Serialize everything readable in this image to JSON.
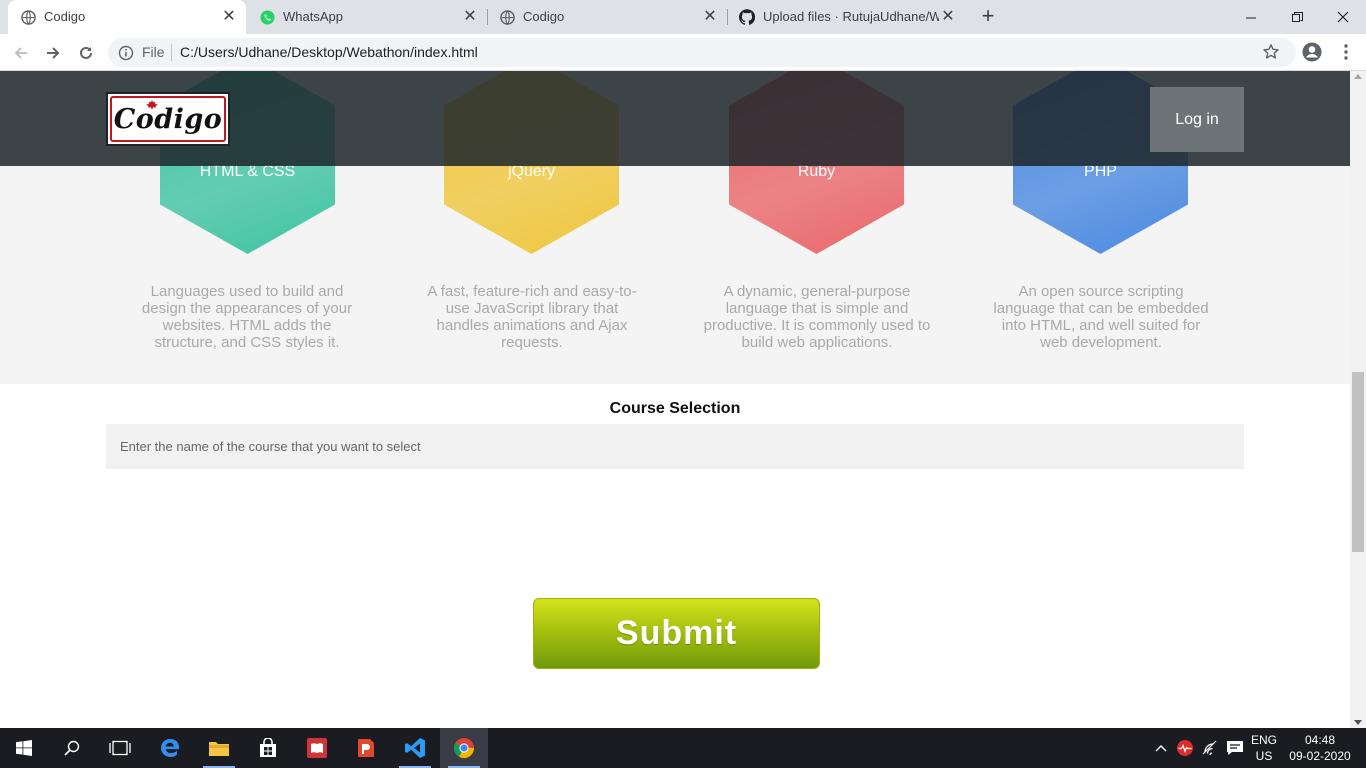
{
  "browser": {
    "tabs": [
      {
        "title": "Codigo",
        "icon": "globe-icon"
      },
      {
        "title": "WhatsApp",
        "icon": "whatsapp-icon"
      },
      {
        "title": "Codigo",
        "icon": "globe-icon"
      },
      {
        "title": "Upload files · RutujaUdhane/Web",
        "icon": "github-icon"
      }
    ],
    "tab_close": "✕",
    "new_tab": "+",
    "address": {
      "scheme_label": "File",
      "url": "C:/Users/Udhane/Desktop/Webathon/index.html"
    }
  },
  "page": {
    "header": {
      "logo_text": "Codigo",
      "login_label": "Log in"
    },
    "features": [
      {
        "label": "HTML & CSS",
        "color": "#3fc3a2",
        "desc_lines": [
          "Languages used to build and",
          "design the appearances of your",
          "websites. HTML adds the",
          "structure, and CSS styles it."
        ]
      },
      {
        "label": "jQuery",
        "color": "#f0c63c",
        "desc_lines": [
          "A fast, feature-rich and easy-to-",
          "use JavaScript library that",
          "handles animations and Ajax",
          "requests."
        ]
      },
      {
        "label": "Ruby",
        "color": "#e9676a",
        "desc_lines": [
          "A dynamic, general-purpose",
          "language that is simple and",
          "productive. It is commonly used to",
          "build web applications."
        ]
      },
      {
        "label": "PHP",
        "color": "#4a89e0",
        "desc_lines": [
          "An open source scripting",
          "language that can be embedded",
          "into HTML, and well suited for",
          "web development."
        ]
      }
    ],
    "course": {
      "title": "Course Selection",
      "placeholder": "Enter the name of the course that you want to select",
      "value": ""
    },
    "submit_label": "Submit"
  },
  "taskbar": {
    "apps": [
      "start-icon",
      "search-icon",
      "task-view-icon",
      "edge-icon",
      "file-explorer-icon",
      "store-icon",
      "reader-icon",
      "office-lens-icon",
      "vscode-icon",
      "chrome-icon"
    ],
    "lang_line1": "ENG",
    "lang_line2": "US",
    "time": "04:48",
    "date": "09-02-2020"
  }
}
